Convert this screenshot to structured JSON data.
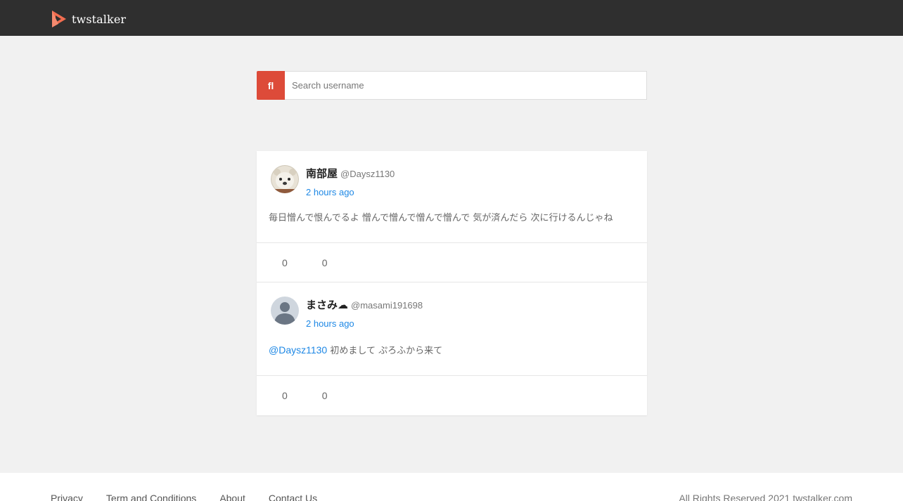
{
  "brand": {
    "name": "twstalker",
    "accent": "#f26d50"
  },
  "search": {
    "button_icon": "ﬂ",
    "button_icon_name": "search-icon",
    "placeholder": "Search username",
    "accent": "#dd4b39"
  },
  "posts": [
    {
      "display_name": "南部屋",
      "handle": "@Daysz1130",
      "time": "2 hours ago",
      "text": "毎日憎んで恨んでるよ 憎んで憎んで憎んで憎んで 気が済んだら 次に行けるんじゃね",
      "mention": "",
      "actions": [
        {
          "icon": "",
          "icon_name": "retweet-icon",
          "count": "0"
        },
        {
          "icon": "",
          "icon_name": "like-icon",
          "count": "0"
        }
      ]
    },
    {
      "display_name": "まさみ☁",
      "handle": "@masami191698",
      "time": "2 hours ago",
      "text": "初めまして ぷろふから来て",
      "mention": "@Daysz1130",
      "actions": [
        {
          "icon": "",
          "icon_name": "retweet-icon",
          "count": "0"
        },
        {
          "icon": "",
          "icon_name": "like-icon",
          "count": "0"
        }
      ]
    }
  ],
  "footer": {
    "links": [
      "Privacy",
      "Term and Conditions",
      "About",
      "Contact Us"
    ],
    "copyright": "All Rights Reserved  2021 twstalker.com"
  }
}
